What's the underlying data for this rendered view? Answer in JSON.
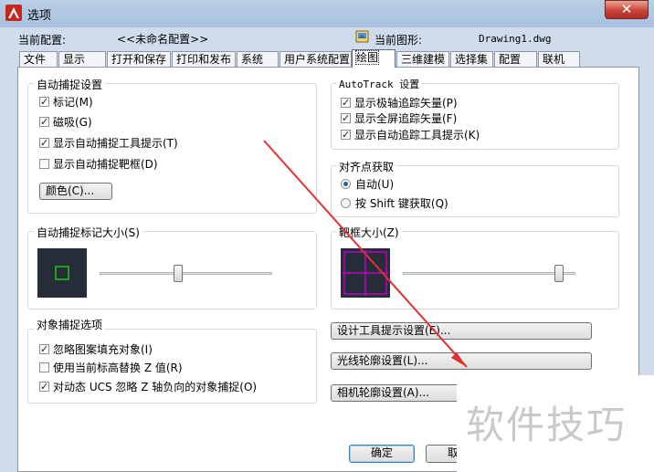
{
  "window": {
    "title": "选项",
    "close_glyph": "✕"
  },
  "config": {
    "current_profile_label": "当前配置:",
    "current_profile_value": "<<未命名配置>>",
    "current_drawing_label": "当前图形:",
    "current_drawing_value": "Drawing1.dwg"
  },
  "tabs": [
    {
      "label": "文件"
    },
    {
      "label": "显示"
    },
    {
      "label": "打开和保存"
    },
    {
      "label": "打印和发布"
    },
    {
      "label": "系统"
    },
    {
      "label": "用户系统配置"
    },
    {
      "label": "绘图",
      "active": true
    },
    {
      "label": "三维建模"
    },
    {
      "label": "选择集"
    },
    {
      "label": "配置"
    },
    {
      "label": "联机"
    }
  ],
  "autosnap": {
    "title": "自动捕捉设置",
    "options": [
      {
        "label": "标记(M)",
        "checked": true
      },
      {
        "label": "磁吸(G)",
        "checked": true
      },
      {
        "label": "显示自动捕捉工具提示(T)",
        "checked": true
      },
      {
        "label": "显示自动捕捉靶框(D)",
        "checked": false
      }
    ],
    "color_button": "颜色(C)..."
  },
  "autotrack": {
    "title": "AutoTrack 设置",
    "options": [
      {
        "label": "显示极轴追踪矢量(P)",
        "checked": true
      },
      {
        "label": "显示全屏追踪矢量(F)",
        "checked": true
      },
      {
        "label": "显示自动追踪工具提示(K)",
        "checked": true
      }
    ]
  },
  "alignment": {
    "title": "对齐点获取",
    "options": [
      {
        "label": "自动(U)",
        "selected": true
      },
      {
        "label": "按 Shift 键获取(Q)",
        "selected": false
      }
    ]
  },
  "marker_size": {
    "title": "自动捕捉标记大小(S)",
    "level": 0.45
  },
  "aperture_size": {
    "title": "靶框大小(Z)",
    "level": 0.93
  },
  "object_snap": {
    "title": "对象捕捉选项",
    "options": [
      {
        "label": "忽略图案填充对象(I)",
        "checked": true
      },
      {
        "label": "使用当前标高替换 Z 值(R)",
        "checked": false
      },
      {
        "label": "对动态 UCS 忽略 Z 轴负向的对象捕捉(O)",
        "checked": true
      }
    ]
  },
  "right_buttons": {
    "design_tooltip": "设计工具提示设置(E)...",
    "light_glyph": "光线轮廓设置(L)...",
    "camera_glyph": "相机轮廓设置(A)..."
  },
  "footer": {
    "ok": "确定",
    "cancel": "取消"
  },
  "watermark": "软件技巧",
  "colors": {
    "marker_green": "#1ec81e",
    "aperture_magenta": "#c000c0",
    "preview_bg": "#262c38",
    "arrow_red": "#e03030"
  }
}
